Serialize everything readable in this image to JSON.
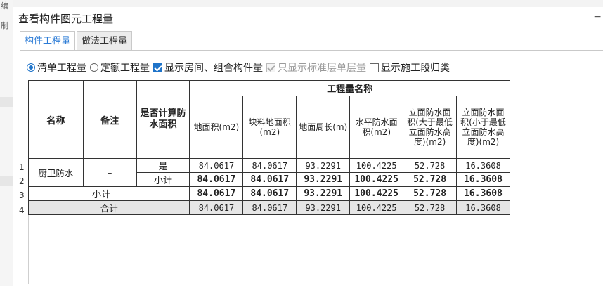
{
  "dialog": {
    "title": "查看构件图元工程量",
    "minimize_glyph": "−"
  },
  "background": {
    "left_fragments": [
      "编",
      "制"
    ]
  },
  "tabs": [
    {
      "label": "构件工程量",
      "active": true
    },
    {
      "label": "做法工程量",
      "active": false
    }
  ],
  "options": {
    "bill_quantity": {
      "label": "清单工程量",
      "selected": true
    },
    "quota_quantity": {
      "label": "定额工程量",
      "selected": false
    },
    "show_rooms": {
      "label": "显示房间、组合构件量",
      "checked": true
    },
    "standard_floor_only": {
      "label": "只显示标准层单层量",
      "checked": true,
      "disabled": true
    },
    "show_construction": {
      "label": "显示施工段归类",
      "checked": false
    }
  },
  "table": {
    "group_header": "工程量名称",
    "headers": {
      "name": "名称",
      "note": "备注",
      "calc_waterproof": "是否计算防水面积",
      "floor_area": "地面积(m2)",
      "block_floor_area": "块料地面积(m2)",
      "floor_perimeter": "地面周长(m)",
      "horizontal_waterproof": "水平防水面积(m2)",
      "vertical_above": "立面防水面积(大于最低立面防水高度)(m2)",
      "vertical_below": "立面防水面积(小于最低立面防水高度)(m2)"
    },
    "row_numbers": [
      "1",
      "2",
      "3",
      "4"
    ],
    "rows": {
      "r1": {
        "name": "厨卫防水",
        "note": "–",
        "calc": "是",
        "v": [
          "84.0617",
          "84.0617",
          "93.2291",
          "100.4225",
          "52.728",
          "16.3608"
        ]
      },
      "r2": {
        "calc": "小计",
        "v": [
          "84.0617",
          "84.0617",
          "93.2291",
          "100.4225",
          "52.728",
          "16.3608"
        ]
      },
      "r3": {
        "label": "小计",
        "v": [
          "84.0617",
          "84.0617",
          "93.2291",
          "100.4225",
          "52.728",
          "16.3608"
        ]
      },
      "r4": {
        "label": "合计",
        "v": [
          "84.0617",
          "84.0617",
          "93.2291",
          "100.4225",
          "52.728",
          "16.3608"
        ]
      }
    }
  },
  "colors": {
    "accent": "#1e73c9",
    "active_tab_text": "#2b7bd6",
    "total_row_bg": "#e6e6e6"
  }
}
